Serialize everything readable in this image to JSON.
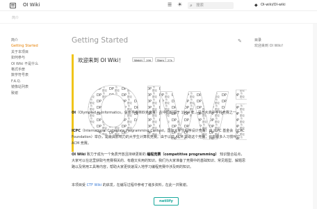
{
  "header": {
    "site_title": "OI Wiki",
    "search_placeholder": "搜索",
    "repo_label": "OI-wiki/OI-wiki"
  },
  "tabs": {
    "home": "简介"
  },
  "sidebar": {
    "items": [
      {
        "label": "简介",
        "active": false
      },
      {
        "label": "Getting Started",
        "active": true
      },
      {
        "label": "关于本项目",
        "active": false
      },
      {
        "label": "如何参与",
        "active": false
      },
      {
        "label": "OI Wiki 不是什么",
        "active": false
      },
      {
        "label": "格式手册",
        "active": false
      },
      {
        "label": "数学符号表",
        "active": false
      },
      {
        "label": "F.A.Q.",
        "active": false
      },
      {
        "label": "镜像站列表",
        "active": false
      },
      {
        "label": "致谢",
        "active": false
      }
    ]
  },
  "main": {
    "page_title": "Getting Started",
    "welcome_title": "欢迎来到 OI Wiki！",
    "badges": [
      {
        "label": "Watch",
        "count": "196"
      },
      {
        "label": "Stars",
        "count": "27k"
      }
    ],
    "wordcloud_words": [
      "OI",
      "Wiki"
    ],
    "para1_bold": "OI",
    "para1_text": "（Olympiad in Informatics，信息学奥林匹克竞赛）在中国起源于 1984 年，是五大高中学科竞赛之一。",
    "para2_bold": "ICPC",
    "para2_text": "（International Collegiate Programming Contest，国际大学生程序设计竞赛）由 ICPC 基金会（ICPC Foundation）举办，是最具影响力的大学生计算机竞赛。由于以前 ACM 赞助这个竞赛，也有很多人习惯叫它 ACM 竞赛。",
    "para3_bold": "OI Wiki",
    "para3_text_a": " 致力于成为一个免费开放且持续更新的 ",
    "para3_bold2": "编程竞赛（competitive programming）",
    "para3_text_b": " 知识整合站点，大家可以在这里获取与竞赛相关的、有趣又实用的知识。我们为大家准备了竞赛中的基础知识、常见题型、解题思路以及常用工具等内容，帮助大家更快速深入地学习编程竞赛中涉及到的知识。",
    "para4_text_a": "本项目受 ",
    "para4_link": "CTF Wiki",
    "para4_text_b": " 的启发，在编写过程中参考了诸多资料，在此一并致谢。",
    "netlify_label": "netlify"
  },
  "toc": {
    "title": "目录",
    "items": [
      "欢迎来到 OI Wiki！"
    ]
  }
}
